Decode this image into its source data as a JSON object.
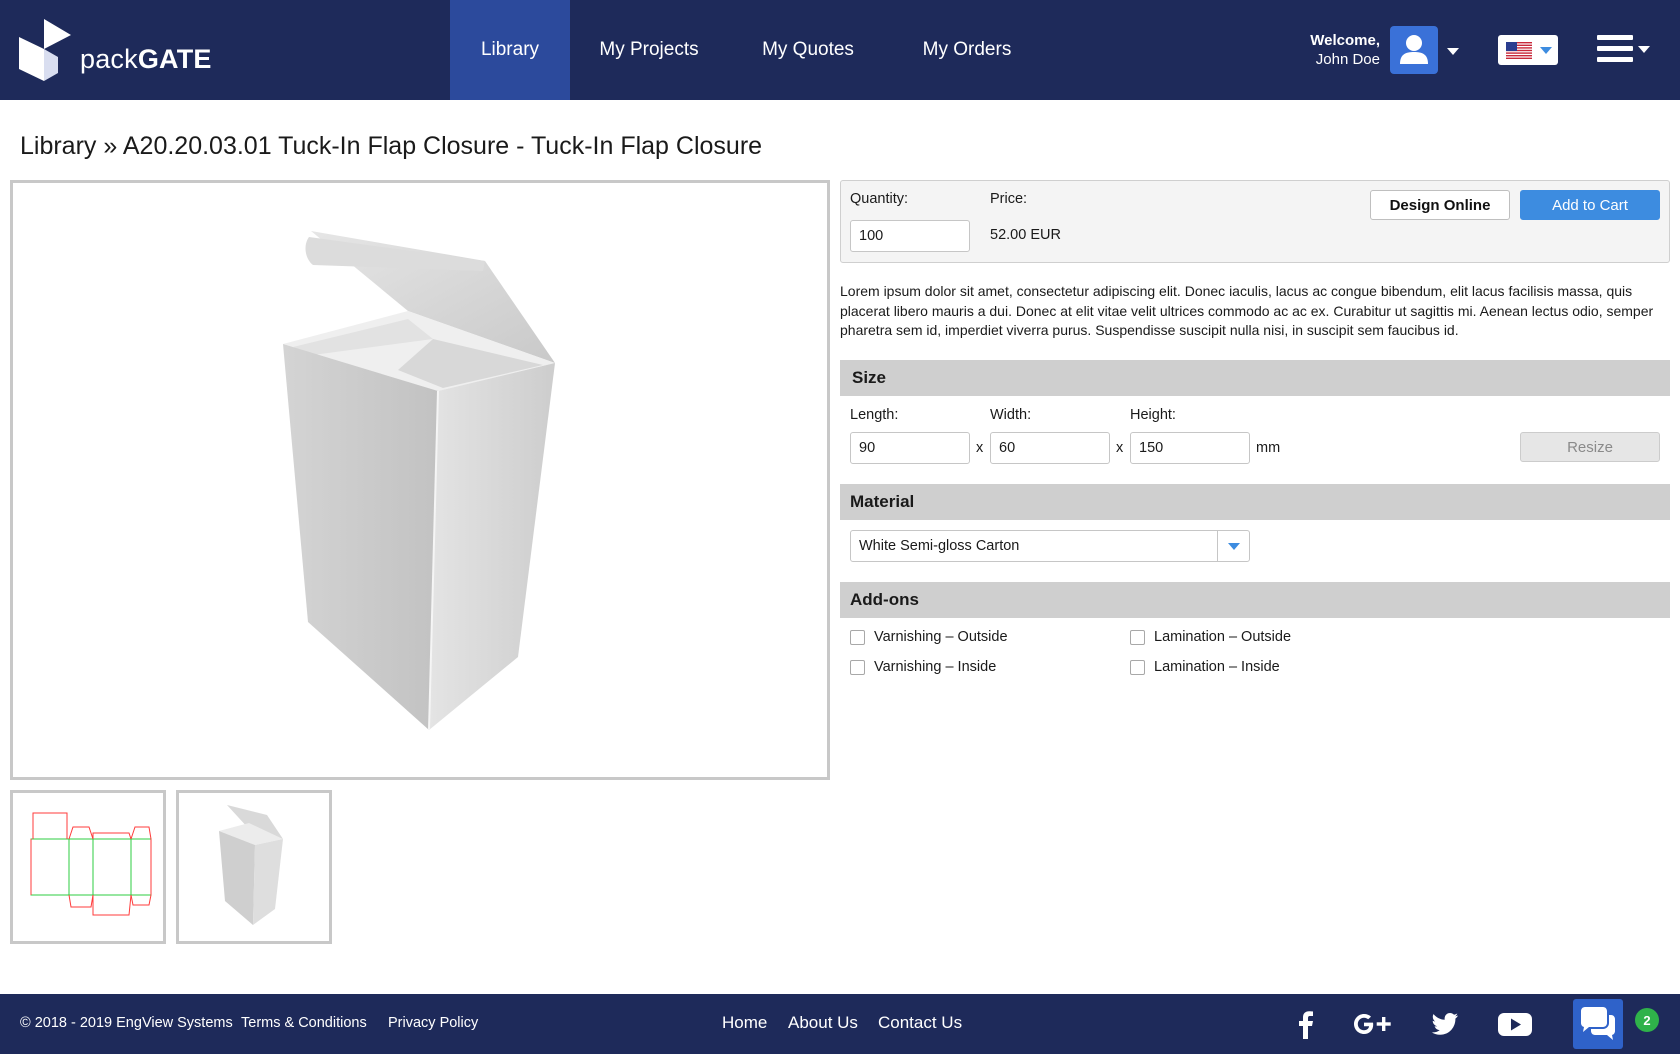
{
  "header": {
    "brand_light": "pack",
    "brand_bold": "GATE",
    "nav": [
      {
        "label": "Library",
        "active": true
      },
      {
        "label": "My Projects"
      },
      {
        "label": "My Quotes"
      },
      {
        "label": "My Orders"
      }
    ],
    "welcome_label": "Welcome,",
    "user_name": "John Doe",
    "icons": {
      "avatar": "user-icon",
      "language": "us-flag-icon",
      "menu": "hamburger-icon"
    },
    "colors": {
      "bar": "#1e2a5a",
      "active_tab": "#2c4a9c",
      "avatar_bg": "#3a71d8"
    }
  },
  "breadcrumb": {
    "root": "Library",
    "separator": "»",
    "current": "A20.20.03.01 Tuck-In Flap Closure - Tuck-In Flap Closure"
  },
  "order": {
    "quantity_label": "Quantity:",
    "quantity_value": "100",
    "price_label": "Price:",
    "price_value": "52.00 EUR",
    "design_online_label": "Design Online",
    "add_to_cart_label": "Add to Cart"
  },
  "description": "Lorem ipsum dolor sit amet, consectetur adipiscing elit. Donec iaculis, lacus ac congue bibendum, elit lacus facilisis massa, quis placerat libero mauris a dui. Donec at elit vitae velit ultrices commodo ac ac ex. Curabitur ut sagittis mi. Aenean lectus odio, semper pharetra sem id, imperdiet viverra purus. Suspendisse suscipit nulla nisi, in suscipit sem faucibus id.",
  "size": {
    "title": "Size",
    "length_label": "Length:",
    "length_value": "90",
    "width_label": "Width:",
    "width_value": "60",
    "height_label": "Height:",
    "height_value": "150",
    "separator": "x",
    "unit": "mm",
    "resize_label": "Resize"
  },
  "material": {
    "title": "Material",
    "selected": "White Semi-gloss Carton"
  },
  "addons": {
    "title": "Add-ons",
    "items": [
      {
        "label": "Varnishing – Outside",
        "checked": false
      },
      {
        "label": "Varnishing – Inside",
        "checked": false
      },
      {
        "label": "Lamination – Outside",
        "checked": false
      },
      {
        "label": "Lamination – Inside",
        "checked": false
      }
    ]
  },
  "footer": {
    "copyright": "© 2018 - 2019 EngView Systems",
    "terms": "Terms & Conditions",
    "privacy": "Privacy Policy",
    "nav": [
      "Home",
      "About Us",
      "Contact Us"
    ],
    "social_icons": [
      "facebook-icon",
      "google-plus-icon",
      "twitter-icon",
      "youtube-icon"
    ],
    "chat_icon": "chat-icon",
    "chat_count": "2",
    "colors": {
      "bar": "#1e2a5a",
      "chat_bg": "#2f62c9",
      "badge": "#2fb24a"
    }
  }
}
